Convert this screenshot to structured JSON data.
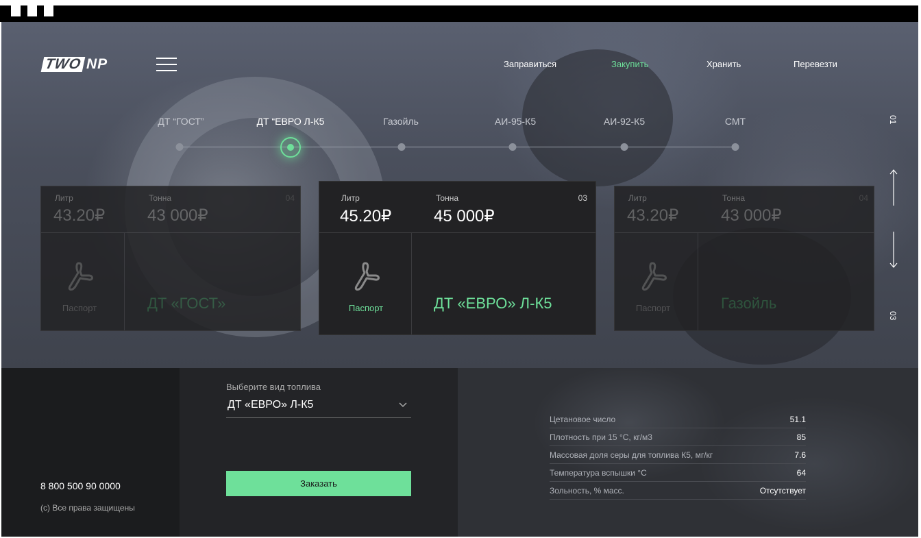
{
  "brand": {
    "logo_box": "TWO",
    "logo_rest": "NP"
  },
  "nav": [
    "Заправиться",
    "Закупить",
    "Хранить",
    "Перевезти"
  ],
  "nav_active_index": 1,
  "fuel_tabs": [
    "ДТ “ГОСТ”",
    "ДТ “ЕВРО Л-К5",
    "Газойль",
    "АИ-95-К5",
    "АИ-92-К5",
    "СМТ"
  ],
  "fuel_tab_active_index": 1,
  "pager": {
    "top": "01",
    "bottom": "03"
  },
  "cards": [
    {
      "litre_label": "Литр",
      "ton_label": "Тонна",
      "litre_price": "43.20₽",
      "ton_price": "43 000₽",
      "number": "04",
      "passport": "Паспорт",
      "title": "ДТ «ГОСТ»"
    },
    {
      "litre_label": "Литр",
      "ton_label": "Тонна",
      "litre_price": "45.20₽",
      "ton_price": "45 000₽",
      "number": "03",
      "passport": "Паспорт",
      "title": "ДТ «ЕВРО» Л-К5"
    },
    {
      "litre_label": "Литр",
      "ton_label": "Тонна",
      "litre_price": "43.20₽",
      "ton_price": "43 000₽",
      "number": "04",
      "passport": "Паспорт",
      "title": "Газойль"
    }
  ],
  "footer": {
    "phone": "8 800 500 90 0000",
    "copyright": "(с) Все права защищены",
    "select_label": "Выберите вид топлива",
    "select_value": "ДТ «ЕВРО» Л-К5",
    "order_button": "Заказать",
    "specs": [
      {
        "name": "Цетановое число",
        "value": "51.1"
      },
      {
        "name": "Плотность при 15 °С, кг/м3",
        "value": "85"
      },
      {
        "name": "Массовая доля серы для топлива К5, мг/кг",
        "value": "7.6"
      },
      {
        "name": "Температура вспышки °С",
        "value": "64"
      },
      {
        "name": "Зольность, % масс.",
        "value": "Отсутствует"
      }
    ]
  },
  "colors": {
    "accent": "#6ee09a",
    "card_bg": "#222224",
    "footer_bg": "#2e3034"
  },
  "icons": [
    "hamburger-menu-icon",
    "pdf-icon",
    "arrow-up-icon",
    "arrow-down-icon",
    "chevron-down-icon"
  ]
}
